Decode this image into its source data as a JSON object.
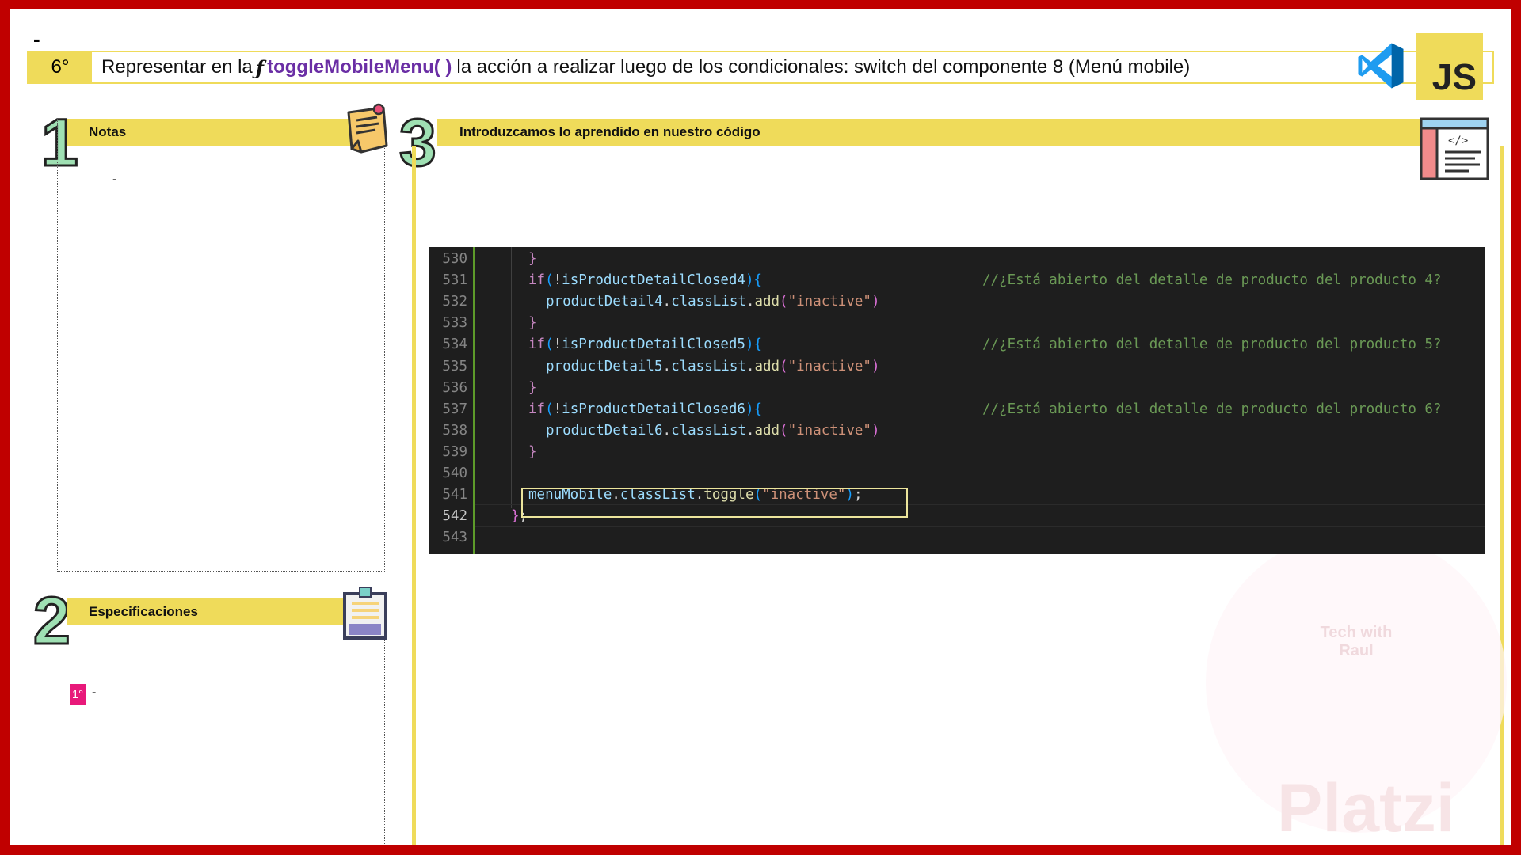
{
  "header": {
    "dash": "-",
    "step_number": "6°",
    "title_prefix": "Representar en la",
    "title_f": "ƒ",
    "title_function": "toggleMobileMenu( )",
    "title_suffix": "la acción a realizar luego de los condicionales: switch del componente 8 (Menú mobile)",
    "js_badge": "JS"
  },
  "notes": {
    "number": "1",
    "title": "Notas",
    "content": "-"
  },
  "specs": {
    "number": "2",
    "title": "Especificaciones",
    "item_badge": "1°",
    "item_text": "-"
  },
  "code_section": {
    "number": "3",
    "title": "Introduzcamos lo aprendido en nuestro código"
  },
  "code": {
    "lines": [
      {
        "n": "530",
        "a": "}"
      },
      {
        "n": "531",
        "a": "if",
        "b": "(",
        "c": "!",
        "d": "isProductDetailClosed4",
        "e": ")",
        "f": "{",
        "cm": "//¿Está abierto del detalle de producto del producto 4?"
      },
      {
        "n": "532",
        "v1": "productDetail4",
        "p1": ".",
        "v2": "classList",
        "p2": ".",
        "fn": "add",
        "o": "(",
        "s": "\"inactive\"",
        "cl": ")"
      },
      {
        "n": "533",
        "a": "}"
      },
      {
        "n": "534",
        "a": "if",
        "b": "(",
        "c": "!",
        "d": "isProductDetailClosed5",
        "e": ")",
        "f": "{",
        "cm": "//¿Está abierto del detalle de producto del producto 5?"
      },
      {
        "n": "535",
        "v1": "productDetail5",
        "p1": ".",
        "v2": "classList",
        "p2": ".",
        "fn": "add",
        "o": "(",
        "s": "\"inactive\"",
        "cl": ")"
      },
      {
        "n": "536",
        "a": "}"
      },
      {
        "n": "537",
        "a": "if",
        "b": "(",
        "c": "!",
        "d": "isProductDetailClosed6",
        "e": ")",
        "f": "{",
        "cm": "//¿Está abierto del detalle de producto del producto 6?"
      },
      {
        "n": "538",
        "v1": "productDetail6",
        "p1": ".",
        "v2": "classList",
        "p2": ".",
        "fn": "add",
        "o": "(",
        "s": "\"inactive\"",
        "cl": ")"
      },
      {
        "n": "539",
        "a": "}"
      },
      {
        "n": "540"
      },
      {
        "n": "541",
        "v1": "menuMobile",
        "p1": ".",
        "v2": "classList",
        "p2": ".",
        "fn": "toggle",
        "o": "(",
        "s": "\"inactive\"",
        "cl": ")",
        "end": ";"
      },
      {
        "n": "542",
        "a": "}",
        "b": ";"
      },
      {
        "n": "543"
      }
    ]
  },
  "watermark": {
    "brand": "Platzi",
    "logo_line1": "Tech with",
    "logo_line2": "Raul"
  },
  "colors": {
    "frame": "#c00000",
    "accent_yellow": "#efdb5a",
    "number_green": "#9fe0b3",
    "function_purple": "#6a2ea5",
    "badge_pink": "#e8197a"
  }
}
